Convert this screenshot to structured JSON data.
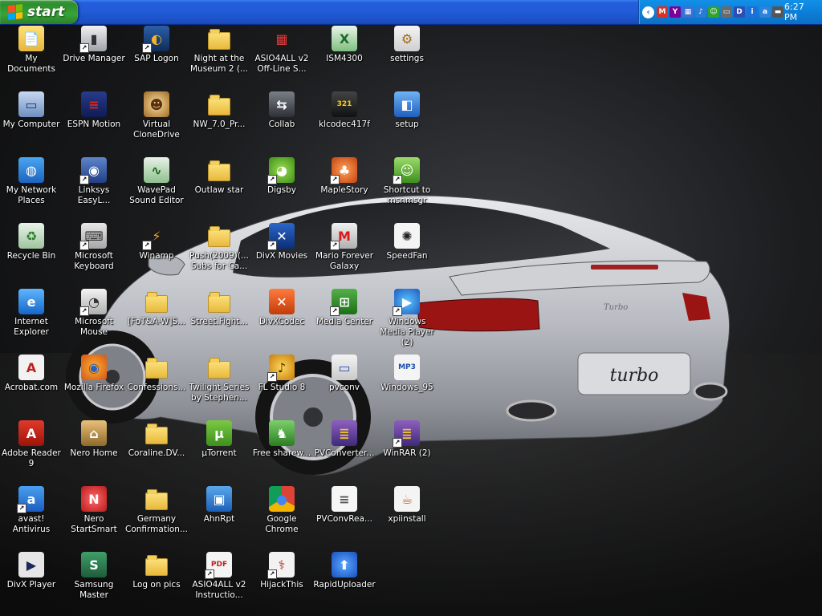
{
  "taskbar": {
    "start_label": "start",
    "clock": "6:27 PM",
    "tray_icons": [
      {
        "name": "collapse-arrow-icon",
        "glyph": "‹",
        "color": "#ffffff"
      },
      {
        "name": "gmail-icon",
        "glyph": "M",
        "color": "#d93025"
      },
      {
        "name": "yahoo-icon",
        "glyph": "Y",
        "color": "#7b0099"
      },
      {
        "name": "network-icon",
        "glyph": "▦",
        "color": "#3d6fd6"
      },
      {
        "name": "volume-icon",
        "glyph": "♪",
        "color": "#2a7bd6"
      },
      {
        "name": "msn-icon",
        "glyph": "☺",
        "color": "#2fa32f"
      },
      {
        "name": "drive-icon",
        "glyph": "▭",
        "color": "#6a6a6a"
      },
      {
        "name": "digsby-icon",
        "glyph": "D",
        "color": "#2b4fb4"
      },
      {
        "name": "security-icon",
        "glyph": "i",
        "color": "#1d6fd9"
      },
      {
        "name": "avast-tray-icon",
        "glyph": "a",
        "color": "#2f82d8"
      },
      {
        "name": "battery-icon",
        "glyph": "▬",
        "color": "#555555"
      }
    ]
  },
  "icons": [
    {
      "label": "My Documents",
      "kind": "mydocs",
      "col": 0,
      "row": 0,
      "short": false
    },
    {
      "label": "My Computer",
      "kind": "computer",
      "col": 0,
      "row": 1,
      "short": false
    },
    {
      "label": "My Network Places",
      "kind": "network",
      "col": 0,
      "row": 2,
      "short": false
    },
    {
      "label": "Recycle Bin",
      "kind": "recycle",
      "col": 0,
      "row": 3,
      "short": false
    },
    {
      "label": "Internet Explorer",
      "kind": "ie",
      "col": 0,
      "row": 4,
      "short": false
    },
    {
      "label": "Acrobat.com",
      "kind": "acrobat",
      "col": 0,
      "row": 5,
      "short": false
    },
    {
      "label": "Adobe Reader 9",
      "kind": "reader",
      "col": 0,
      "row": 6,
      "short": false
    },
    {
      "label": "avast! Antivirus",
      "kind": "avast",
      "col": 0,
      "row": 7,
      "short": true
    },
    {
      "label": "DivX Player",
      "kind": "divxplayer",
      "col": 0,
      "row": 8,
      "short": false
    },
    {
      "label": "Drive Manager",
      "kind": "drivemgr",
      "col": 1,
      "row": 0,
      "short": true
    },
    {
      "label": "ESPN Motion",
      "kind": "espn",
      "col": 1,
      "row": 1,
      "short": false
    },
    {
      "label": "Linksys EasyL...",
      "kind": "linksys",
      "col": 1,
      "row": 2,
      "short": true
    },
    {
      "label": "Microsoft Keyboard",
      "kind": "keyboard",
      "col": 1,
      "row": 3,
      "short": true
    },
    {
      "label": "Microsoft Mouse",
      "kind": "mouse",
      "col": 1,
      "row": 4,
      "short": true
    },
    {
      "label": "Mozilla Firefox",
      "kind": "firefox",
      "col": 1,
      "row": 5,
      "short": false
    },
    {
      "label": "Nero Home",
      "kind": "nerohome",
      "col": 1,
      "row": 6,
      "short": false
    },
    {
      "label": "Nero StartSmart",
      "kind": "nero",
      "col": 1,
      "row": 7,
      "short": false
    },
    {
      "label": "Samsung Master",
      "kind": "samsung",
      "col": 1,
      "row": 8,
      "short": false
    },
    {
      "label": "SAP Logon",
      "kind": "sap",
      "col": 2,
      "row": 0,
      "short": true
    },
    {
      "label": "Virtual CloneDrive",
      "kind": "clonedrive",
      "col": 2,
      "row": 1,
      "short": false
    },
    {
      "label": "WavePad Sound Editor",
      "kind": "wavepad",
      "col": 2,
      "row": 2,
      "short": false
    },
    {
      "label": "Winamp",
      "kind": "winamp",
      "col": 2,
      "row": 3,
      "short": true
    },
    {
      "label": "[FoT&A-W]S...",
      "kind": "folder",
      "col": 2,
      "row": 4,
      "short": false
    },
    {
      "label": "Confessions...",
      "kind": "folder",
      "col": 2,
      "row": 5,
      "short": false
    },
    {
      "label": "Coraline.DV...",
      "kind": "folder",
      "col": 2,
      "row": 6,
      "short": false
    },
    {
      "label": "Germany Confirmation...",
      "kind": "folder",
      "col": 2,
      "row": 7,
      "short": false
    },
    {
      "label": "Log on pics",
      "kind": "folder",
      "col": 2,
      "row": 8,
      "short": false
    },
    {
      "label": "Night at the Museum 2 (...",
      "kind": "folder",
      "col": 3,
      "row": 0,
      "short": false
    },
    {
      "label": "NW_7.0_Pr...",
      "kind": "folder",
      "col": 3,
      "row": 1,
      "short": false
    },
    {
      "label": "Outlaw star",
      "kind": "folder",
      "col": 3,
      "row": 2,
      "short": false
    },
    {
      "label": "Push(2009)(... Subs for Ca...",
      "kind": "folder",
      "col": 3,
      "row": 3,
      "short": false
    },
    {
      "label": "Street.Fight...",
      "kind": "folder",
      "col": 3,
      "row": 4,
      "short": false
    },
    {
      "label": "Twilight Series by Stephen...",
      "kind": "folder",
      "col": 3,
      "row": 5,
      "short": false
    },
    {
      "label": "µTorrent",
      "kind": "utorrent",
      "col": 3,
      "row": 6,
      "short": false
    },
    {
      "label": "AhnRpt",
      "kind": "ahnrpt",
      "col": 3,
      "row": 7,
      "short": false
    },
    {
      "label": "ASIO4ALL v2 Instructio...",
      "kind": "pdf",
      "col": 3,
      "row": 8,
      "short": true
    },
    {
      "label": "ASIO4ALL v2 Off-Line S...",
      "kind": "asio",
      "col": 4,
      "row": 0,
      "short": false
    },
    {
      "label": "Collab",
      "kind": "collab",
      "col": 4,
      "row": 1,
      "short": false
    },
    {
      "label": "Digsby",
      "kind": "digsby",
      "col": 4,
      "row": 2,
      "short": true
    },
    {
      "label": "DivX Movies",
      "kind": "divxmovies",
      "col": 4,
      "row": 3,
      "short": true
    },
    {
      "label": "DivXCodec",
      "kind": "divxcodec",
      "col": 4,
      "row": 4,
      "short": false
    },
    {
      "label": "FL Studio 8",
      "kind": "flstudio",
      "col": 4,
      "row": 5,
      "short": true
    },
    {
      "label": "Free sharew...",
      "kind": "freeshare",
      "col": 4,
      "row": 6,
      "short": false
    },
    {
      "label": "Google Chrome",
      "kind": "chrome",
      "col": 4,
      "row": 7,
      "short": false
    },
    {
      "label": "HijackThis",
      "kind": "hijack",
      "col": 4,
      "row": 8,
      "short": true
    },
    {
      "label": "ISM4300",
      "kind": "excel",
      "col": 5,
      "row": 0,
      "short": false
    },
    {
      "label": "klcodec417f",
      "kind": "klcodec",
      "col": 5,
      "row": 1,
      "short": false
    },
    {
      "label": "MapleStory",
      "kind": "maple",
      "col": 5,
      "row": 2,
      "short": true
    },
    {
      "label": "Mario Forever Galaxy",
      "kind": "mario",
      "col": 5,
      "row": 3,
      "short": true
    },
    {
      "label": "Media Center",
      "kind": "mediacenter",
      "col": 5,
      "row": 4,
      "short": true
    },
    {
      "label": "pvconv",
      "kind": "pvconv",
      "col": 5,
      "row": 5,
      "short": false
    },
    {
      "label": "PVConverter...",
      "kind": "winrar",
      "col": 5,
      "row": 6,
      "short": false
    },
    {
      "label": "PVConvRea...",
      "kind": "textdoc",
      "col": 5,
      "row": 7,
      "short": false
    },
    {
      "label": "RapidUploader",
      "kind": "rapid",
      "col": 5,
      "row": 8,
      "short": false
    },
    {
      "label": "settings",
      "kind": "settings",
      "col": 6,
      "row": 0,
      "short": false
    },
    {
      "label": "setup",
      "kind": "setup",
      "col": 6,
      "row": 1,
      "short": false
    },
    {
      "label": "Shortcut to msnmsgr",
      "kind": "msn",
      "col": 6,
      "row": 2,
      "short": true
    },
    {
      "label": "SpeedFan",
      "kind": "speedfan",
      "col": 6,
      "row": 3,
      "short": false
    },
    {
      "label": "Windows Media Player (2)",
      "kind": "wmp",
      "col": 6,
      "row": 4,
      "short": true
    },
    {
      "label": "Windows_95",
      "kind": "mp3",
      "col": 6,
      "row": 5,
      "short": false
    },
    {
      "label": "WinRAR (2)",
      "kind": "winrar",
      "col": 6,
      "row": 6,
      "short": true
    },
    {
      "label": "xpiinstall",
      "kind": "java",
      "col": 6,
      "row": 7,
      "short": false
    }
  ],
  "wallpaper": {
    "plate_text": "turbo",
    "badge_text": "Turbo"
  }
}
